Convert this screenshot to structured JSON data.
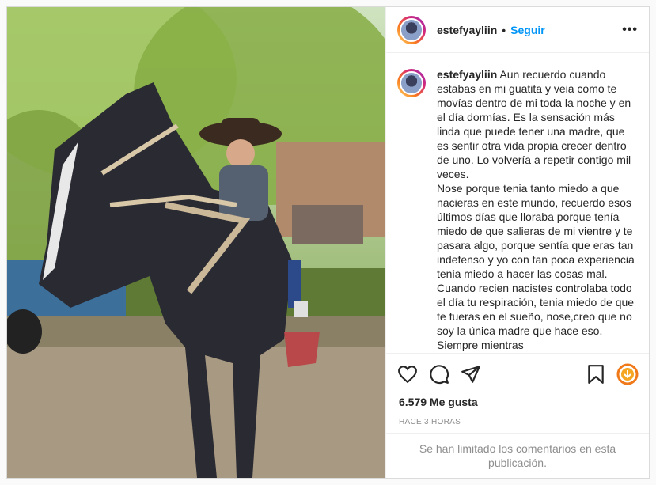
{
  "header": {
    "username": "estefyayliin",
    "separator": "•",
    "follow_label": "Seguir",
    "more_label": "•••"
  },
  "caption": {
    "username": "estefyayliin",
    "text": "Aun recuerdo cuando estabas en mi guatita y veia como te movías dentro de mi toda la noche y en el día dormías. Es la sensación más linda que puede tener una madre, que es sentir otra vida propia crecer dentro de uno. Lo volvería a repetir contigo mil veces.\nNose porque tenia tanto miedo a que nacieras en este mundo, recuerdo esos últimos días que lloraba porque tenía miedo de que salieras de mi vientre y te pasara algo, porque sentía que eras tan indefenso y yo con tan poca experiencia tenia miedo a hacer las cosas mal. Cuando recien nacistes controlaba todo el día tu respiración, tenia miedo de que te fueras en el sueño, nose,creo que no soy la única madre que hace eso. Siempre mientras"
  },
  "actions": {
    "icons": [
      "heart-icon",
      "comment-icon",
      "share-icon",
      "bookmark-icon",
      "download-icon"
    ]
  },
  "likes": "6.579 Me gusta",
  "timestamp": "HACE 3 HORAS",
  "comments_limited": "Se han limitado los comentarios en esta publicación.",
  "colors": {
    "accent": "#0095f6",
    "text": "#262626",
    "muted": "#8e8e8e"
  }
}
